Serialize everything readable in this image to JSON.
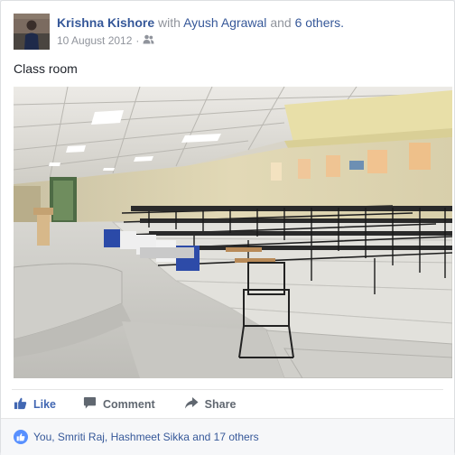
{
  "post": {
    "author": "Krishna Kishore",
    "with_word": "with",
    "tagged_person": "Ayush Agrawal",
    "and_word": "and",
    "others_link": "6 others.",
    "date": "10 August 2012",
    "separator": "·",
    "audience_icon": "friends-icon",
    "text": "Class room"
  },
  "actions": {
    "like_label": "Like",
    "comment_label": "Comment",
    "share_label": "Share"
  },
  "reactions": {
    "summary": "You, Smriti Raj, Hashmeet Sikka and 17 others",
    "icon": "like-icon"
  },
  "colors": {
    "link": "#365899",
    "like_blue": "#4267b2",
    "muted": "#90949c",
    "action_gray": "#606770"
  }
}
